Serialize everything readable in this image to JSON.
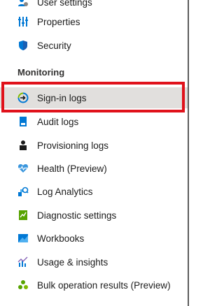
{
  "nav": {
    "top_items": [
      {
        "label": "User settings",
        "icon": "user-settings-icon"
      },
      {
        "label": "Properties",
        "icon": "properties-icon"
      },
      {
        "label": "Security",
        "icon": "shield-icon"
      }
    ],
    "section_header": "Monitoring",
    "monitoring_items": [
      {
        "label": "Sign-in logs",
        "icon": "sign-in-logs-icon",
        "selected": true
      },
      {
        "label": "Audit logs",
        "icon": "audit-logs-icon"
      },
      {
        "label": "Provisioning logs",
        "icon": "provisioning-logs-icon"
      },
      {
        "label": "Health (Preview)",
        "icon": "health-icon"
      },
      {
        "label": "Log Analytics",
        "icon": "log-analytics-icon"
      },
      {
        "label": "Diagnostic settings",
        "icon": "diagnostic-settings-icon"
      },
      {
        "label": "Workbooks",
        "icon": "workbooks-icon"
      },
      {
        "label": "Usage & insights",
        "icon": "usage-insights-icon"
      },
      {
        "label": "Bulk operation results (Preview)",
        "icon": "bulk-operation-icon"
      }
    ]
  },
  "colors": {
    "highlight_border": "#e0121b",
    "selected_bg": "#e1dfdd",
    "accent_blue": "#0078d4"
  }
}
